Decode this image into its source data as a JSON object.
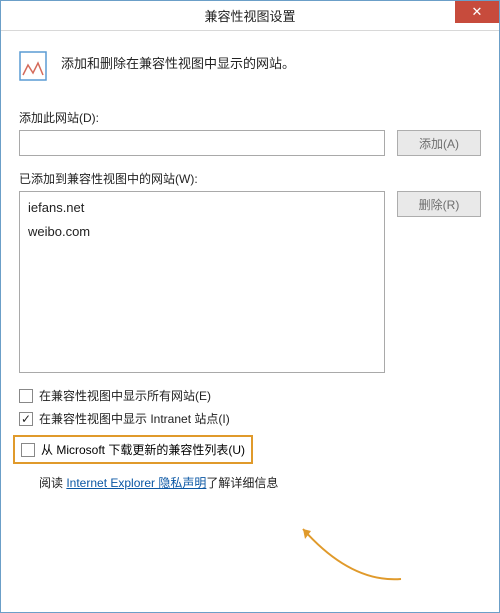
{
  "title": "兼容性视图设置",
  "description": "添加和删除在兼容性视图中显示的网站。",
  "addSite": {
    "label": "添加此网站(D):",
    "value": "",
    "buttonLabel": "添加(A)"
  },
  "addedSites": {
    "label": "已添加到兼容性视图中的网站(W):",
    "items": [
      "iefans.net",
      "weibo.com"
    ],
    "removeButtonLabel": "删除(R)"
  },
  "checkboxes": {
    "displayAll": {
      "label": "在兼容性视图中显示所有网站(E)",
      "checked": false
    },
    "displayIntranet": {
      "label": "在兼容性视图中显示 Intranet 站点(I)",
      "checked": true
    },
    "downloadList": {
      "label": "从 Microsoft 下载更新的兼容性列表(U)",
      "checked": false
    }
  },
  "privacy": {
    "prefix": "阅读 ",
    "link": "Internet Explorer 隐私声明",
    "suffix": "了解详细信息"
  }
}
